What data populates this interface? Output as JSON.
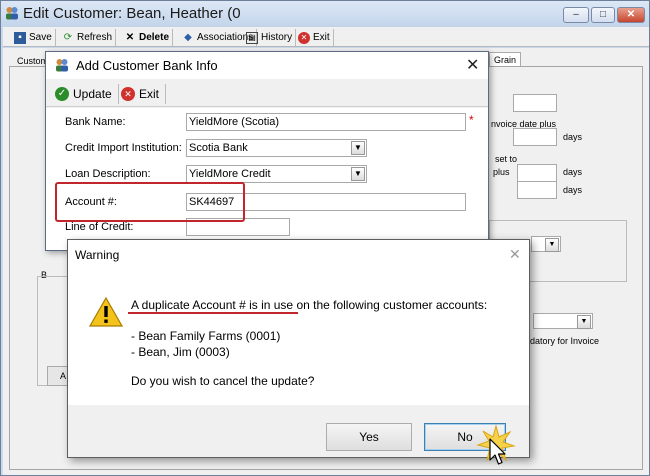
{
  "main_window": {
    "title": "Edit Customer: Bean, Heather (0",
    "controls": [
      "–",
      "□",
      "✕"
    ],
    "toolbar": [
      {
        "label": "Save",
        "icon": "save-icon"
      },
      {
        "label": "Refresh",
        "icon": "refresh-icon"
      },
      {
        "label": "Delete",
        "icon": "delete-icon"
      },
      {
        "label": "Associations",
        "icon": "associations-icon"
      },
      {
        "label": "History",
        "icon": "history-icon"
      },
      {
        "label": "Exit",
        "icon": "exit-icon"
      }
    ],
    "tabs": [
      "Custom",
      "Grain"
    ],
    "bg_labels": {
      "invoice_date": "nvoice date plus",
      "days1": "days",
      "set_to": "set to",
      "plus": "plus",
      "days2": "days",
      "days3": "days",
      "mandatory": "ndatory for Invoice",
      "group_b": "B",
      "btn_a": "A"
    }
  },
  "bank_dialog": {
    "title": "Add Customer Bank Info",
    "toolbar": {
      "update": "Update",
      "exit": "Exit"
    },
    "fields": {
      "bank_name": {
        "label": "Bank Name:",
        "value": "YieldMore (Scotia)",
        "required": "*"
      },
      "credit_import": {
        "label": "Credit Import Institution:",
        "value": "Scotia Bank"
      },
      "loan_desc": {
        "label": "Loan Description:",
        "value": "YieldMore Credit"
      },
      "account": {
        "label": "Account #:",
        "value": "SK44697"
      },
      "line_of_credit": {
        "label": "Line of Credit:",
        "value": ""
      }
    }
  },
  "warning_dialog": {
    "title": "Warning",
    "message": "A duplicate Account # is in use on the following customer accounts:",
    "accounts": [
      "- Bean Family Farms (0001)",
      "- Bean, Jim (0003)"
    ],
    "question": "Do you wish to cancel the update?",
    "yes": "Yes",
    "no": "No"
  },
  "colors": {
    "highlight": "#c0262c",
    "accent": "#3c7fb1"
  }
}
